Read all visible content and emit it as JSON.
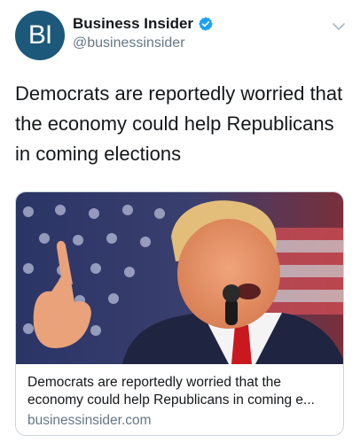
{
  "account": {
    "avatar_text": "BI",
    "display_name": "Business Insider",
    "handle": "@businessinsider",
    "verified": true
  },
  "tweet": {
    "text": "Democrats are reportedly worried that the economy could help Republicans in coming elections"
  },
  "card": {
    "title_line1": "Democrats are reportedly worried that the",
    "title_line2": "economy could help Republicans in coming e...",
    "domain": "businessinsider.com"
  },
  "icons": {
    "verified": "verified-badge-icon",
    "caret": "chevron-down-icon"
  },
  "colors": {
    "avatar_bg": "#1c5879",
    "verified_blue": "#1da1f2",
    "secondary_text": "#657786"
  }
}
